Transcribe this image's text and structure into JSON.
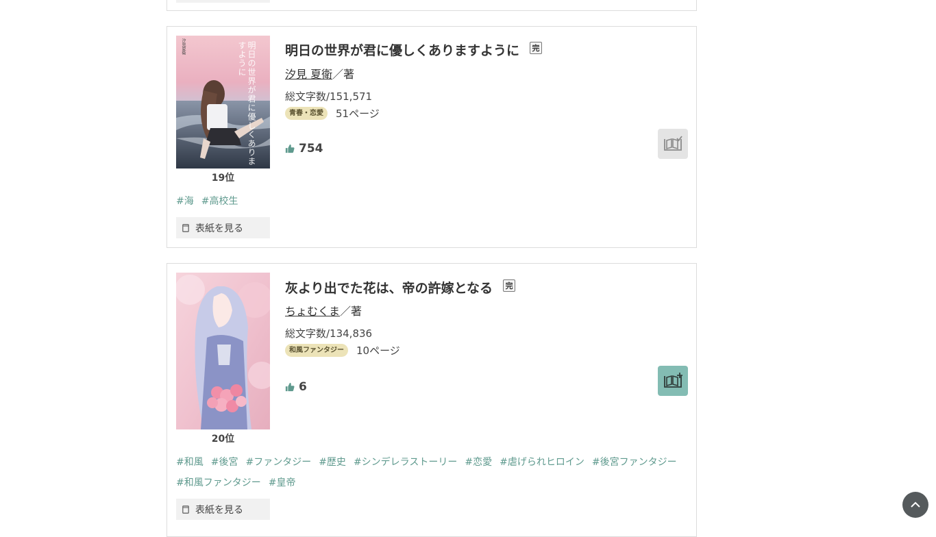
{
  "works": [
    {
      "rank": "19位",
      "title": "明日の世界が君に優しくありますように",
      "completed_badge": "完",
      "author_name": "汐見 夏衛",
      "author_suffix": "／著",
      "char_count": "総文字数/151,571",
      "genre": "青春・恋愛",
      "pages": "51ページ",
      "likes": "754",
      "cover_text": "明日の世界が君に優しくありますように",
      "cover_author": "汐見夏衛",
      "shelf_icon": "bookshelf-check-icon",
      "tags": [
        "#海",
        "#高校生"
      ],
      "view_cover_label": "表紙を見る"
    },
    {
      "rank": "20位",
      "title": "灰より出でた花は、帝の許嫁となる",
      "completed_badge": "完",
      "author_name": "ちょむくま",
      "author_suffix": "／著",
      "char_count": "総文字数/134,836",
      "genre": "和風ファンタジー",
      "pages": "10ページ",
      "likes": "6",
      "shelf_icon": "bookshelf-add-icon",
      "tags": [
        "#和風",
        "#後宮",
        "#ファンタジー",
        "#歴史",
        "#シンデレラストーリー",
        "#恋愛",
        "#虐げられヒロイン",
        "#後宮ファンタジー",
        "#和風ファンタジー",
        "#皇帝"
      ],
      "view_cover_label": "表紙を見る"
    }
  ],
  "colors": {
    "tag": "#5f9a8e",
    "genre_bg": "#ece3b8",
    "shelf_added_bg": "#e4e4e4",
    "shelf_add_bg": "#83bcb3",
    "like_icon": "#5f9a8e",
    "scroll_top_bg": "#555a5c"
  },
  "icons": {
    "like": "thumbs-up-icon",
    "view_cover": "book-icon",
    "scroll_top": "chevron-up-icon"
  }
}
